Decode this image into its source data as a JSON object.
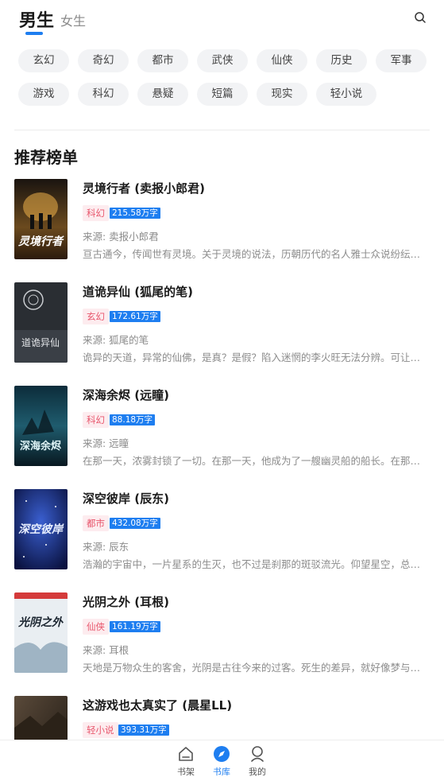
{
  "header": {
    "tab_male": "男生",
    "tab_female": "女生",
    "accent": "#1e7ef0"
  },
  "categories": [
    "玄幻",
    "奇幻",
    "都市",
    "武侠",
    "仙侠",
    "历史",
    "军事",
    "游戏",
    "科幻",
    "悬疑",
    "短篇",
    "现实",
    "轻小说"
  ],
  "section_title": "推荐榜单",
  "books": [
    {
      "title": "灵境行者 (卖报小郎君)",
      "category": "科幻",
      "words": "215.58万字",
      "source": "来源: 卖报小郎君",
      "desc": "亘古通今，传闻世有灵境。关于灵境的说法，历朝历代的名人雅士众说纷纭，见仁见智……",
      "cover_text": "灵境行者"
    },
    {
      "title": "道诡异仙 (狐尾的笔)",
      "category": "玄幻",
      "words": "172.61万字",
      "source": "来源: 狐尾的笔",
      "desc": "诡异的天道，异常的仙佛，是真？是假？陷入迷惘的李火旺无法分辨。可让他更恐惧的是……",
      "cover_text": "道诡异仙"
    },
    {
      "title": "深海余烬 (远瞳)",
      "category": "科幻",
      "words": "88.18万字",
      "source": "来源: 远瞳",
      "desc": "在那一天，浓雾封锁了一切。在那一天，他成为了一艘幽灵船的船长。在那一天，他跨过……",
      "cover_text": "深海余烬"
    },
    {
      "title": "深空彼岸 (辰东)",
      "category": "都市",
      "words": "432.08万字",
      "source": "来源: 辰东",
      "desc": "浩瀚的宇宙中，一片星系的生灭，也不过是刹那的斑驳流光。仰望星空，总有种结局已注定……",
      "cover_text": "深空彼岸"
    },
    {
      "title": "光阴之外 (耳根)",
      "category": "仙侠",
      "words": "161.19万字",
      "source": "来源: 耳根",
      "desc": "天地是万物众生的客舍，光阴是古往今来的过客。死生的差异，就好像梦与醒的不同……",
      "cover_text": "光阴之外"
    },
    {
      "title": "这游戏也太真实了 (晨星LL)",
      "category": "轻小说",
      "words": "393.31万字",
      "source": "",
      "desc": "",
      "cover_text": ""
    }
  ],
  "nav": [
    {
      "label": "书架",
      "icon": "bookshelf-icon"
    },
    {
      "label": "书库",
      "icon": "compass-icon"
    },
    {
      "label": "我的",
      "icon": "user-icon"
    }
  ]
}
